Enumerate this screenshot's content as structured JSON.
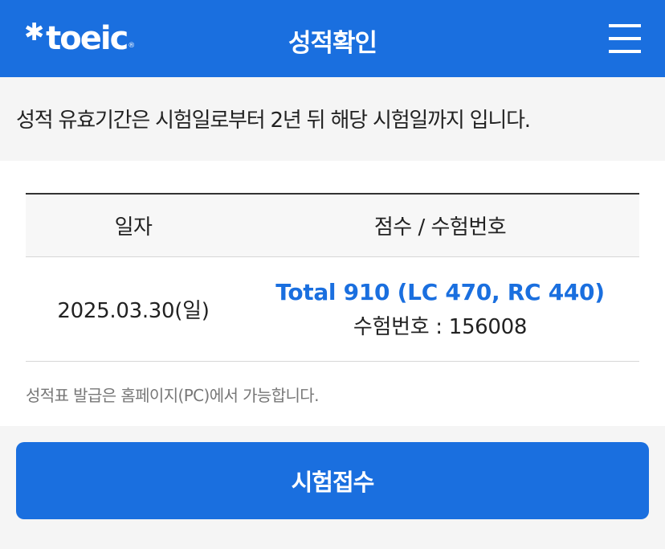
{
  "header": {
    "logo_star": "✱",
    "logo_text": "toeic",
    "logo_reg": "®",
    "title": "성적확인",
    "menu_icon": "hamburger-menu-icon"
  },
  "notice": {
    "text": "성적 유효기간은 시험일로부터 2년 뒤 해당 시험일까지 입니다."
  },
  "table": {
    "headers": [
      "일자",
      "점수 / 수험번호"
    ],
    "rows": [
      {
        "date": "2025.03.30(일)",
        "score": "Total 910 (LC 470, RC 440)",
        "exam_number": "수험번호 : 156008"
      }
    ]
  },
  "footnote": "성적표 발급은 홈페이지(PC)에서 가능합니다.",
  "apply_button": {
    "label": "시험접수"
  },
  "colors": {
    "brand_blue": "#1a6fdf",
    "background": "#f5f5f5",
    "text": "#222222",
    "muted_text": "#777777"
  }
}
